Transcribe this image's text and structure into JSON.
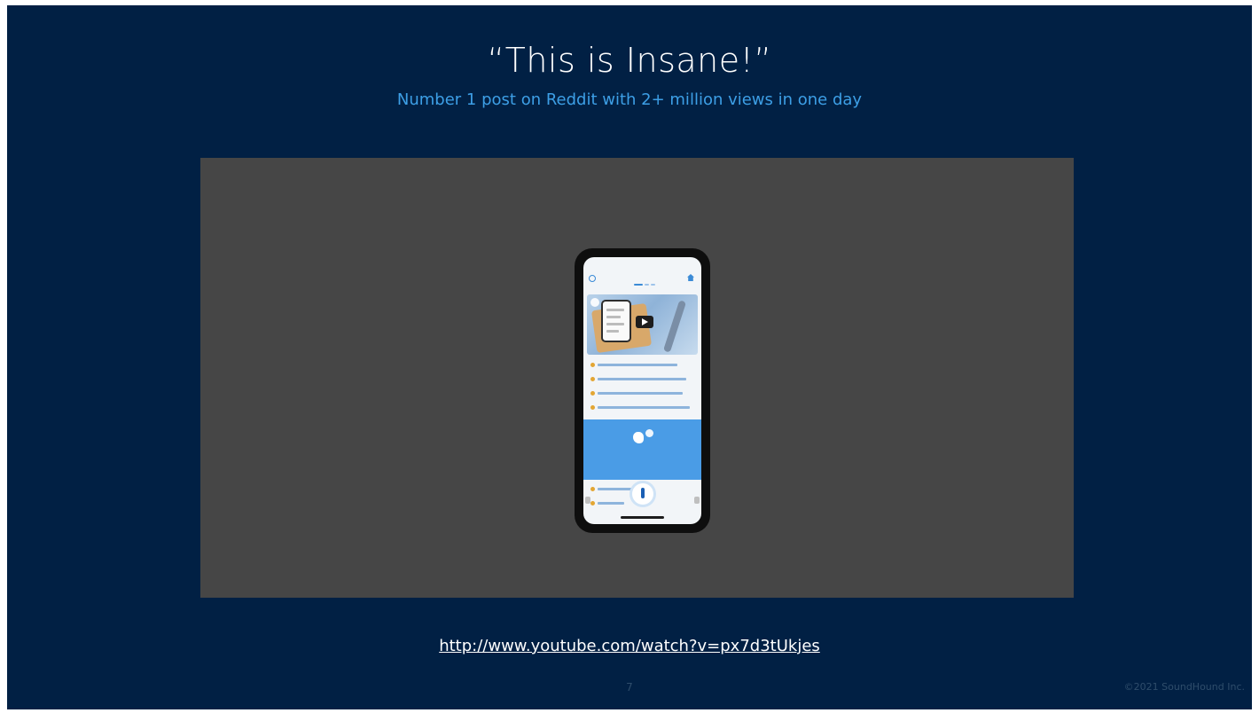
{
  "slide": {
    "title": "“This is Insane!”",
    "subtitle": "Number 1 post on Reddit with 2+ million views in one day",
    "link_text": "http://www.youtube.com/watch?v=px7d3tUkjes",
    "page_number": "7",
    "copyright": "©2021 SoundHound Inc."
  },
  "colors": {
    "background": "#012044",
    "subtitle": "#3d9fe6",
    "video_frame": "#464646",
    "app_accent": "#4a9ce6"
  }
}
